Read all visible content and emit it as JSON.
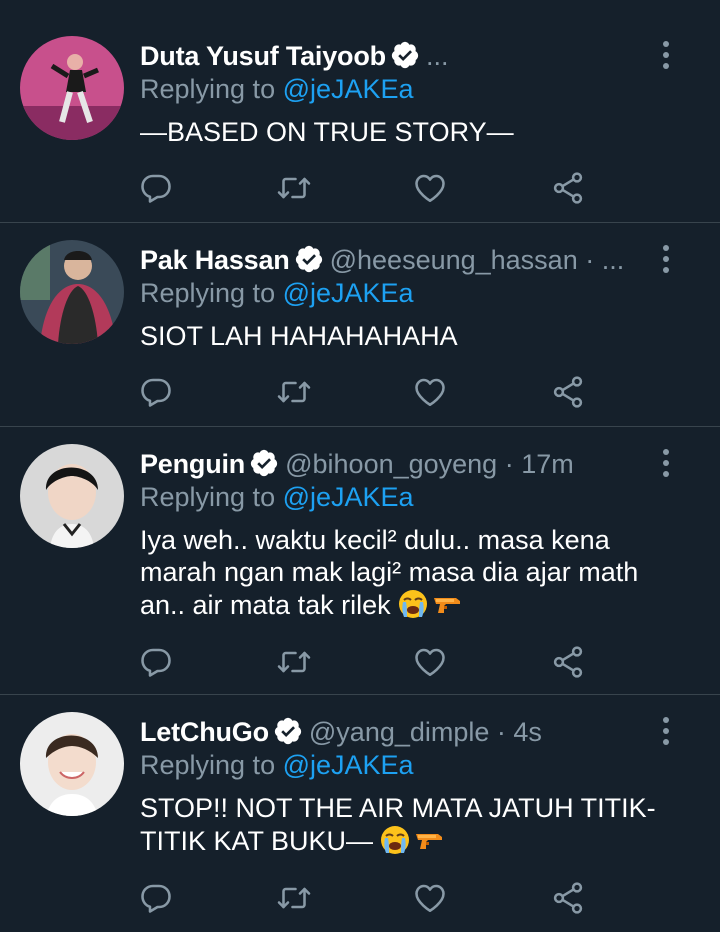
{
  "tweets": [
    {
      "name": "Duta Yusuf Taiyoob",
      "handle": "...",
      "replying_prefix": "Replying to",
      "replying_to": "@jeJAKEa",
      "text_lines": [
        "—BASED ON TRUE STORY—"
      ],
      "emojis": [],
      "avatar": "person-dancing-pink-bg"
    },
    {
      "name": "Pak Hassan",
      "handle": "@heeseung_hassan · ...",
      "replying_prefix": "Replying to",
      "replying_to": "@jeJAKEa",
      "text_lines": [
        "SIOT LAH HAHAHAHAHA"
      ],
      "emojis": [],
      "avatar": "person-puffer-vest"
    },
    {
      "name": "Penguin",
      "handle": "@bihoon_goyeng · 17m",
      "replying_prefix": "Replying to",
      "replying_to": "@jeJAKEa",
      "text_lines": [
        "Iya weh.. waktu kecil² dulu.. masa kena",
        "marah ngan mak lagi² masa dia ajar math",
        "an.. air mata tak rilek"
      ],
      "emojis": [
        "loudly-crying-face",
        "water-pistol"
      ],
      "avatar": "person-black-hair"
    },
    {
      "name": "LetChuGo",
      "handle": "@yang_dimple · 4s",
      "replying_prefix": "Replying to",
      "replying_to": "@jeJAKEa",
      "text_lines": [
        "STOP!! NOT THE AIR MATA JATUH TITIK-",
        "TITIK KAT BUKU—"
      ],
      "emojis": [
        "loudly-crying-face",
        "water-pistol"
      ],
      "avatar": "person-smiling"
    }
  ],
  "icons": {
    "verified": "verified-badge-icon",
    "more": "more-vertical-icon",
    "reply": "reply-icon",
    "retweet": "retweet-icon",
    "like": "like-icon",
    "share": "share-icon"
  },
  "colors": {
    "background": "#15202b",
    "text": "#ffffff",
    "secondary": "#8899a6",
    "accent": "#1da1f2",
    "divider": "#38444d"
  }
}
